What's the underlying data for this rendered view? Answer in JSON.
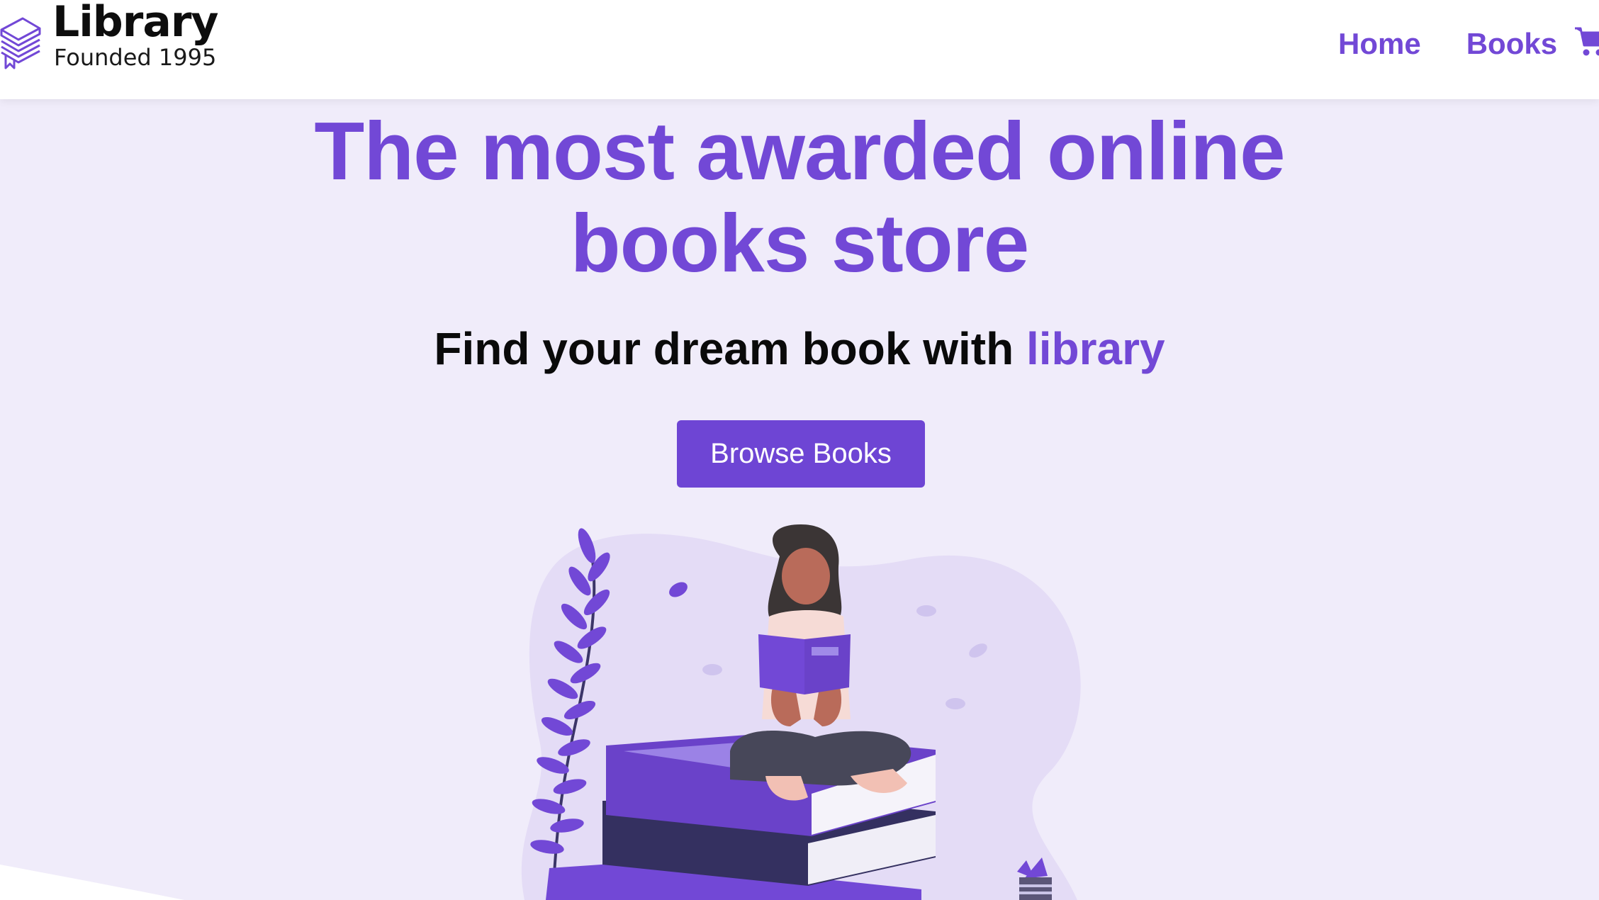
{
  "brand": {
    "name": "Library",
    "tagline": "Founded 1995"
  },
  "nav": {
    "links": [
      "Home",
      "Books"
    ],
    "cart_icon": "shopping-cart-icon"
  },
  "hero": {
    "title": "The most awarded online books store",
    "subtitle_prefix": "Find your dream book with ",
    "subtitle_accent": "library",
    "button_label": "Browse Books"
  },
  "colors": {
    "accent": "#7248d6",
    "background": "#f0ecfa",
    "navbar": "#ffffff",
    "dark_text": "#0a0a0a"
  }
}
